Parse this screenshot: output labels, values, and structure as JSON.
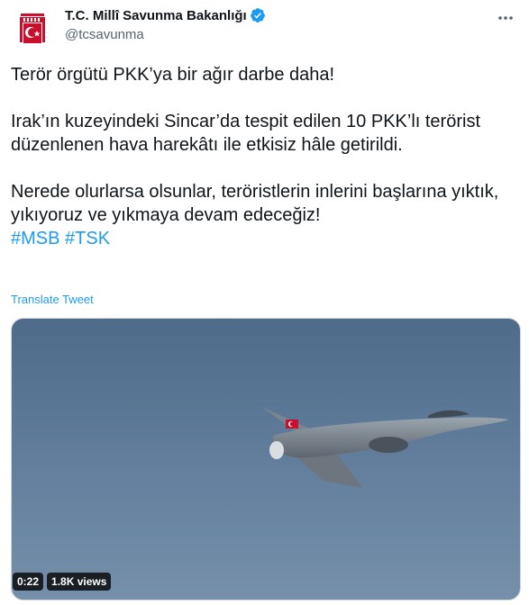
{
  "account": {
    "display_name": "T.C. Millî Savunma Bakanlığı",
    "handle": "@tcsavunma",
    "verified": true,
    "avatar_icon": "turkish-armed-forces-emblem-icon"
  },
  "tweet": {
    "paragraph1": "Terör örgütü PKK’ya bir ağır darbe daha!",
    "paragraph2": "Irak’ın kuzeyindeki Sincar’da tespit edilen 10 PKK’lı terörist düzenlenen hava harekâtı ile etkisiz hâle getirildi.",
    "paragraph3": "Nerede olurlarsa olsunlar, teröristlerin inlerini başlarına yıktık, yıkıyoruz ve yıkmaya devam edeceğiz!",
    "hashtags": [
      "#MSB",
      "#TSK"
    ],
    "translate_label": "Translate Tweet"
  },
  "media": {
    "type": "video",
    "duration": "0:22",
    "views": "1.8K views",
    "subject": "fighter-jet"
  },
  "colors": {
    "accent": "#1d9bf0",
    "text": "#0f1419",
    "secondary": "#536471",
    "emblem_red": "#c8102e"
  }
}
